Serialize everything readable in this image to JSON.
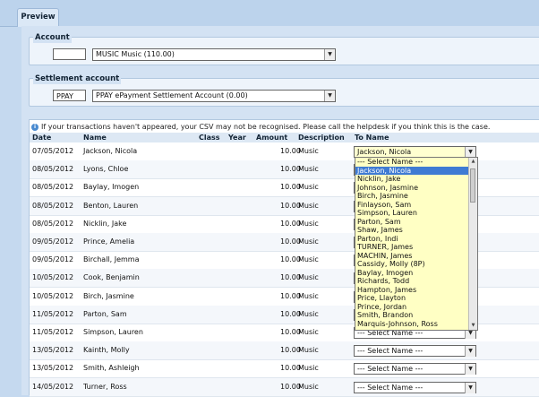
{
  "tab": {
    "label": "Preview"
  },
  "account": {
    "legend": "Account",
    "code": "",
    "selected": "MUSIC Music (110.00)"
  },
  "settlement": {
    "legend": "Settlement account",
    "code": "PPAY",
    "selected": "PPAY ePayment Settlement Account (0.00)"
  },
  "info_text": "If your transactions haven't appeared, your CSV may not be recognised. Please call the helpdesk if you think this is the case.",
  "table": {
    "headers": {
      "date": "Date",
      "name": "Name",
      "class": "Class",
      "year": "Year",
      "amount": "Amount",
      "description": "Description",
      "to_name": "To Name"
    },
    "rows": [
      {
        "date": "07/05/2012",
        "name": "Jackson, Nicola",
        "amount": "10.00",
        "desc": "Music",
        "to": "Jackson, Nicola"
      },
      {
        "date": "08/05/2012",
        "name": "Lyons, Chloe",
        "amount": "10.00",
        "desc": "Music",
        "to": ""
      },
      {
        "date": "08/05/2012",
        "name": "Baylay, Imogen",
        "amount": "10.00",
        "desc": "Music",
        "to": ""
      },
      {
        "date": "08/05/2012",
        "name": "Benton, Lauren",
        "amount": "10.00",
        "desc": "Music",
        "to": ""
      },
      {
        "date": "08/05/2012",
        "name": "Nicklin, Jake",
        "amount": "10.00",
        "desc": "Music",
        "to": ""
      },
      {
        "date": "09/05/2012",
        "name": "Prince, Amelia",
        "amount": "10.00",
        "desc": "Music",
        "to": ""
      },
      {
        "date": "09/05/2012",
        "name": "Birchall, Jemma",
        "amount": "10.00",
        "desc": "Music",
        "to": ""
      },
      {
        "date": "10/05/2012",
        "name": "Cook, Benjamin",
        "amount": "10.00",
        "desc": "Music",
        "to": ""
      },
      {
        "date": "10/05/2012",
        "name": "Birch, Jasmine",
        "amount": "10.00",
        "desc": "Music",
        "to": ""
      },
      {
        "date": "11/05/2012",
        "name": "Parton, Sam",
        "amount": "10.00",
        "desc": "Music",
        "to": ""
      },
      {
        "date": "11/05/2012",
        "name": "Simpson, Lauren",
        "amount": "10.00",
        "desc": "Music",
        "to": "--- Select Name ---"
      },
      {
        "date": "13/05/2012",
        "name": "Kainth, Molly",
        "amount": "10.00",
        "desc": "Music",
        "to": "--- Select Name ---"
      },
      {
        "date": "13/05/2012",
        "name": "Smith, Ashleigh",
        "amount": "10.00",
        "desc": "Music",
        "to": "--- Select Name ---"
      },
      {
        "date": "14/05/2012",
        "name": "Turner, Ross",
        "amount": "10.00",
        "desc": "Music",
        "to": "--- Select Name ---"
      }
    ]
  },
  "dropdown": {
    "options": [
      "--- Select Name ---",
      "Jackson, Nicola",
      "Nicklin, Jake",
      "Johnson, Jasmine",
      "Birch, Jasmine",
      "Finlayson, Sam",
      "Simpson, Lauren",
      "Parton, Sam",
      "Shaw, James",
      "Parton, Indi",
      "TURNER, James",
      "MACHIN, James",
      "Cassidy, Molly (8P)",
      "Baylay, Imogen",
      "Richards, Todd",
      "Hampton, James",
      "Price, Llayton",
      "Prince, Jordan",
      "Smith, Brandon",
      "Marquis-Johnson, Ross"
    ],
    "selected_index": 1
  },
  "colors": {
    "selection": "#3f7bd3",
    "dropdown_bg": "#ffffc4"
  }
}
